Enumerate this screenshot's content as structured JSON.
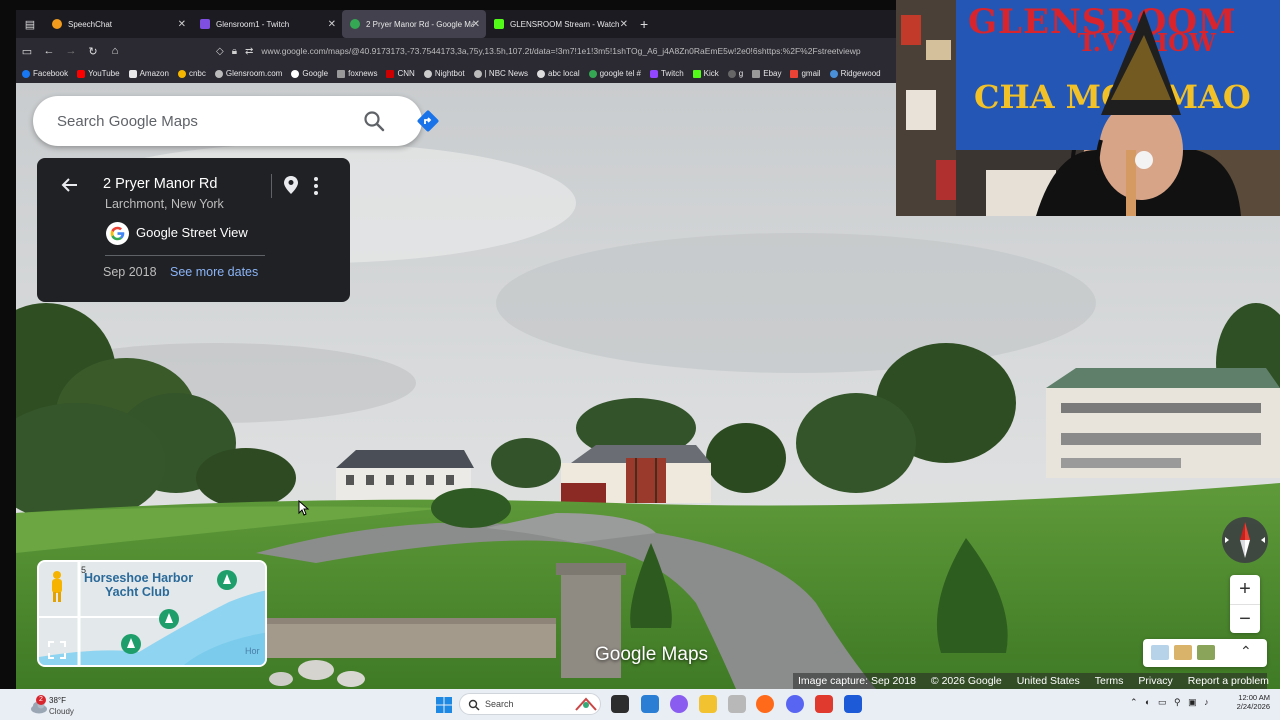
{
  "browser": {
    "tabs": [
      {
        "label": "SpeechChat",
        "active": false
      },
      {
        "label": "Glensroom1 - Twitch",
        "active": false
      },
      {
        "label": "2 Pryer Manor Rd - Google Ma",
        "active": true
      },
      {
        "label": "GLENSROOM Stream - Watch L",
        "active": false
      }
    ],
    "url": "www.google.com/maps/@40.9173173,-73.7544173,3a,75y,13.5h,107.2t/data=!3m7!1e1!3m5!1shTOg_A6_j4A8Zn0RaEmE5w!2e0!6shttps:%2F%2Fstreetviewp",
    "bookmarks": [
      "Facebook",
      "YouTube",
      "Amazon",
      "cnbc",
      "Glensroom.com",
      "Google",
      "foxnews",
      "CNN",
      "Nightbot",
      "| NBC News",
      "abc local",
      "google tel #",
      "Twitch",
      "Kick",
      "g",
      "Ebay",
      "gmail",
      "Ridgewood"
    ]
  },
  "maps": {
    "search_placeholder": "Search Google Maps",
    "place": {
      "title": "2 Pryer Manor Rd",
      "subtitle": "Larchmont, New York",
      "source": "Google Street View",
      "date": "Sep 2018",
      "more_dates": "See more dates"
    },
    "minimap": {
      "label_line1": "Horseshoe Harbor",
      "label_line2": "Yacht Club",
      "edge_label": "Hor",
      "road_number": "5"
    },
    "watermark": "Google Maps",
    "zoom_in": "+",
    "zoom_out": "−",
    "footer": {
      "capture": "Image capture: Sep 2018",
      "copyright": "© 2026 Google",
      "country": "United States",
      "terms": "Terms",
      "privacy": "Privacy",
      "report": "Report a problem"
    }
  },
  "webcam": {
    "banner_line1": "GLENSROOM",
    "banner_line2": "T.V SHOW",
    "banner_line3": "CHA MO   LMAO"
  },
  "taskbar": {
    "weather_temp": "38°F",
    "weather_desc": "Cloudy",
    "weather_badge": "2",
    "search_label": "Search",
    "time": "12:00 AM",
    "date": "2/24/2026"
  },
  "colors": {
    "maps_blue": "#1a73e8",
    "link_blue": "#8ab4f8",
    "card_bg": "#202124",
    "banner_blue": "#2457b5",
    "banner_red": "#d8242c",
    "banner_yellow": "#f2c027"
  }
}
